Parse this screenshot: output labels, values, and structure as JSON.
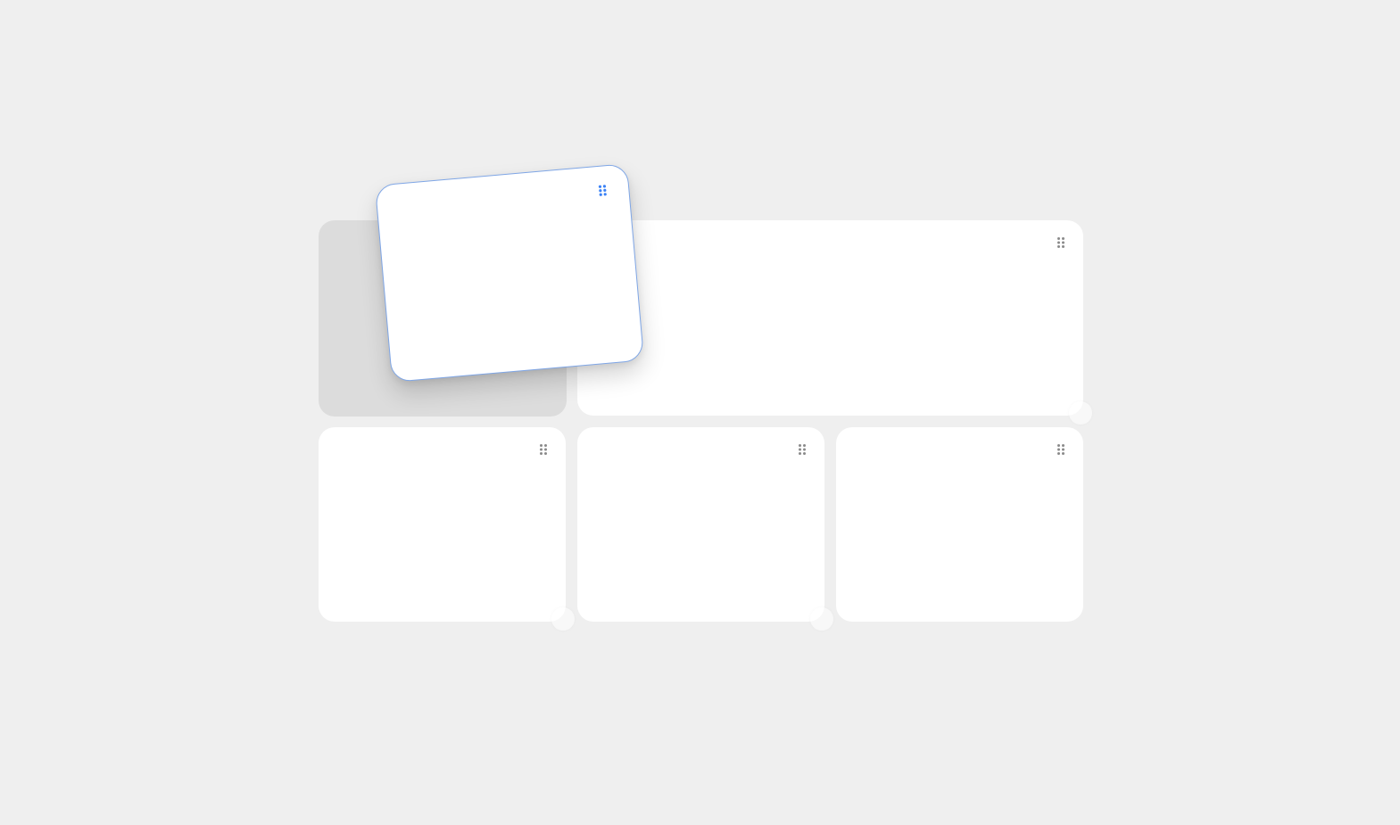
{
  "dashboard": {
    "accent_color": "#3b82f6",
    "handle_color": "#8a8a8a",
    "cards": [
      {
        "id": "dragged-card",
        "state": "dragging",
        "handle_icon": "drag-handle-icon"
      },
      {
        "id": "wide-card",
        "state": "idle",
        "handle_icon": "drag-handle-icon"
      },
      {
        "id": "bottom-card-1",
        "state": "idle",
        "handle_icon": "drag-handle-icon"
      },
      {
        "id": "bottom-card-2",
        "state": "idle",
        "handle_icon": "drag-handle-icon"
      },
      {
        "id": "bottom-card-3",
        "state": "idle",
        "handle_icon": "drag-handle-icon"
      }
    ],
    "drop_placeholder": "drop-target"
  }
}
